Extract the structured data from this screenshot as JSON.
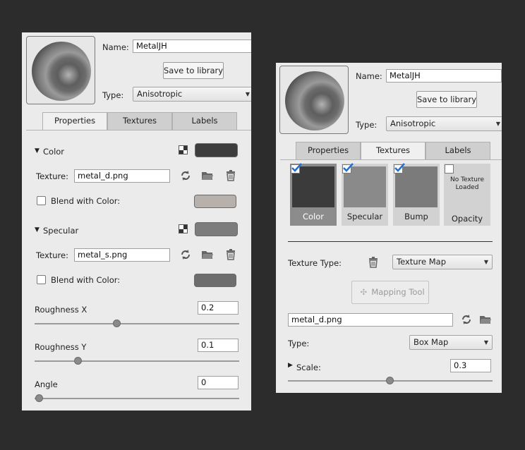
{
  "left_panel": {
    "name_label": "Name:",
    "name_value": "MetalJH",
    "save_button": "Save to library",
    "type_label": "Type:",
    "type_value": "Anisotropic",
    "tabs": [
      "Properties",
      "Textures",
      "Labels"
    ],
    "active_tab": "Properties",
    "color_section": "Color",
    "color_texture_label": "Texture:",
    "color_texture_value": "metal_d.png",
    "color_blend_label": "Blend with Color:",
    "specular_section": "Specular",
    "specular_texture_label": "Texture:",
    "specular_texture_value": "metal_s.png",
    "specular_blend_label": "Blend with Color:",
    "roughness_x_label": "Roughness X",
    "roughness_x_value": "0.2",
    "roughness_y_label": "Roughness Y",
    "roughness_y_value": "0.1",
    "angle_label": "Angle",
    "angle_value": "0",
    "sliders": {
      "roughness_x": 0.4,
      "roughness_y": 0.2,
      "angle": 0.0
    }
  },
  "right_panel": {
    "name_label": "Name:",
    "name_value": "MetalJH",
    "save_button": "Save to library",
    "type_label": "Type:",
    "type_value": "Anisotropic",
    "tabs": [
      "Properties",
      "Textures",
      "Labels"
    ],
    "active_tab": "Textures",
    "texture_slots": [
      {
        "label": "Color",
        "checked": true,
        "selected": true
      },
      {
        "label": "Specular",
        "checked": true,
        "selected": false
      },
      {
        "label": "Bump",
        "checked": true,
        "selected": false
      },
      {
        "label": "Opacity",
        "checked": false,
        "selected": false,
        "empty_text": "No Texture Loaded"
      }
    ],
    "texture_type_label": "Texture Type:",
    "texture_type_value": "Texture Map",
    "mapping_tool_button": "Mapping Tool",
    "file_value": "metal_d.png",
    "type_label2": "Type:",
    "map_type_value": "Box Map",
    "scale_label": "Scale:",
    "scale_value": "0.3",
    "sliders": {
      "scale": 0.5
    }
  },
  "colors": {
    "background": "#2c2c2c",
    "panel": "#ebebeb",
    "checkmark": "#1f6fd6"
  }
}
